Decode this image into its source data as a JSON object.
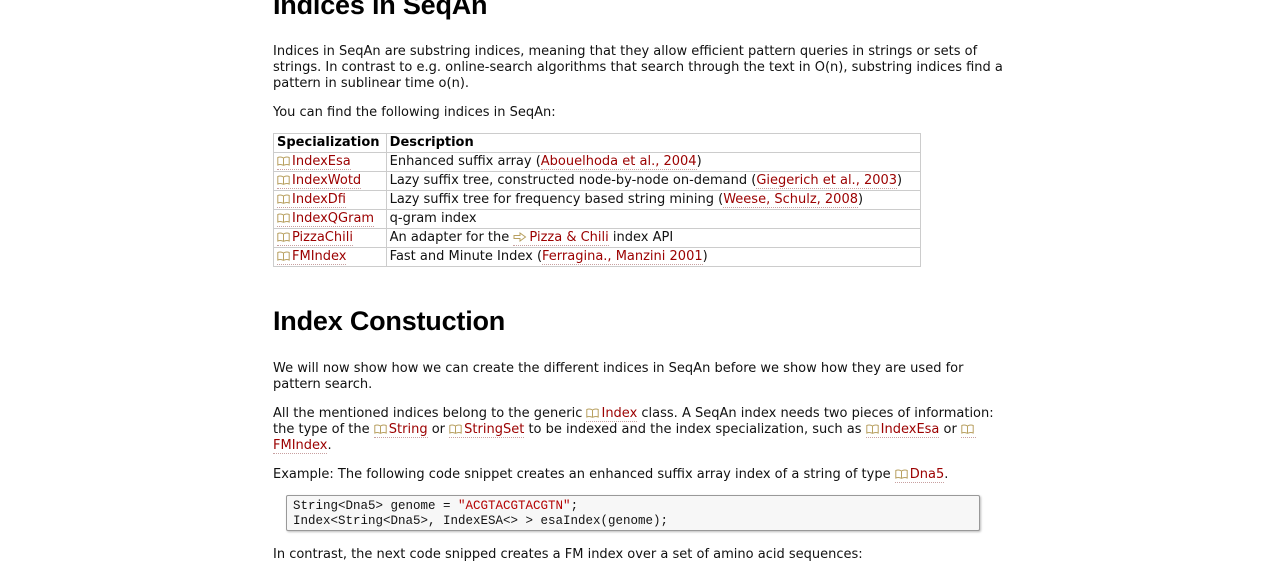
{
  "section1": {
    "title": "Indices in SeqAn",
    "intro": "Indices in SeqAn are substring indices, meaning that they allow efficient pattern queries in strings or sets of strings. In contrast to e.g. online-search algorithms that search through the text in O(n), substring indices find a pattern in sublinear time o(n).",
    "lead": "You can find the following indices in SeqAn:",
    "table": {
      "headers": [
        "Specialization",
        "Description"
      ],
      "rows": [
        {
          "spec": "IndexEsa",
          "desc_before": "Enhanced suffix array (",
          "ref": "Abouelhoda et al., 2004",
          "desc_after": ")"
        },
        {
          "spec": "IndexWotd",
          "desc_before": "Lazy suffix tree, constructed node-by-node on-demand (",
          "ref": "Giegerich et al., 2003",
          "desc_after": ")"
        },
        {
          "spec": "IndexDfi",
          "desc_before": "Lazy suffix tree for frequency based string mining (",
          "ref": "Weese, Schulz, 2008",
          "desc_after": ")"
        },
        {
          "spec": "IndexQGram",
          "desc_before": "q-gram index",
          "ref": "",
          "desc_after": ""
        },
        {
          "spec": "PizzaChili",
          "desc_before": "An adapter for the ",
          "ref": "Pizza & Chili",
          "desc_after": " index API"
        },
        {
          "spec": "FMIndex",
          "desc_before": "Fast and Minute Index (",
          "ref": "Ferragina., Manzini 2001",
          "desc_after": ")"
        }
      ]
    }
  },
  "section2": {
    "title": "Index Constuction",
    "p1": "We will now show how we can create the different indices in SeqAn before we show how they are used for pattern search.",
    "p2": {
      "t1": "All the mentioned indices belong to the generic ",
      "l1": "Index",
      "t2": " class. A SeqAn index needs two pieces of information: the type of the ",
      "l2": "String",
      "t3": " or ",
      "l3": "StringSet",
      "t4": " to be indexed and the index specialization, such as ",
      "l4": "IndexEsa",
      "t5": " or ",
      "l5": "FMIndex",
      "t6": "."
    },
    "p3": {
      "t1": "Example: The following code snippet creates an enhanced suffix array index of a string of type ",
      "l1": "Dna5",
      "t2": "."
    },
    "code": {
      "line1_a": "String<Dna5> genome = ",
      "line1_str": "\"ACGTACGTACGTN\"",
      "line1_b": ";",
      "line2": "Index<String<Dna5>, IndexESA<> > esaIndex(genome);"
    },
    "p4": "In contrast, the next code snipped creates a FM index over a set of amino acid sequences:"
  },
  "colors": {
    "link": "#9b0000",
    "code_string": "#b30000",
    "table_border": "#cccccc"
  }
}
